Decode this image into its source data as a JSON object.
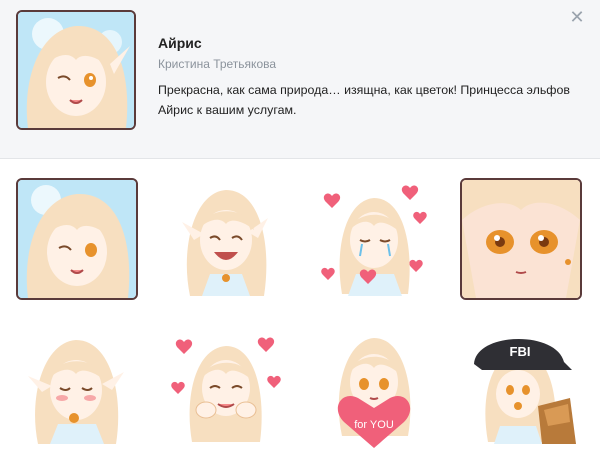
{
  "pack": {
    "title": "Айрис",
    "author": "Кристина Третьякова",
    "description": "Прекрасна, как сама природа… изящна, как цветок! Принцесса эльфов Айрис к вашим услугам."
  },
  "close_icon": "close-icon",
  "stickers": [
    {
      "name": "sticker-wink",
      "framed": true
    },
    {
      "name": "sticker-laugh",
      "framed": false
    },
    {
      "name": "sticker-crying-hearts",
      "framed": false
    },
    {
      "name": "sticker-closeup",
      "framed": true
    },
    {
      "name": "sticker-blush",
      "framed": false
    },
    {
      "name": "sticker-hearts-cheeks",
      "framed": false
    },
    {
      "name": "sticker-for-you",
      "framed": false,
      "text": "for YOU"
    },
    {
      "name": "sticker-fbi",
      "framed": false,
      "text": "FBI"
    }
  ],
  "colors": {
    "hair": "#f7dfc0",
    "hair_shade": "#e9bf94",
    "skin": "#fff1e6",
    "eye": "#e7922c",
    "heart": "#f0607a",
    "frame_bg": "#bfe6f7",
    "cap": "#2f2f34"
  }
}
